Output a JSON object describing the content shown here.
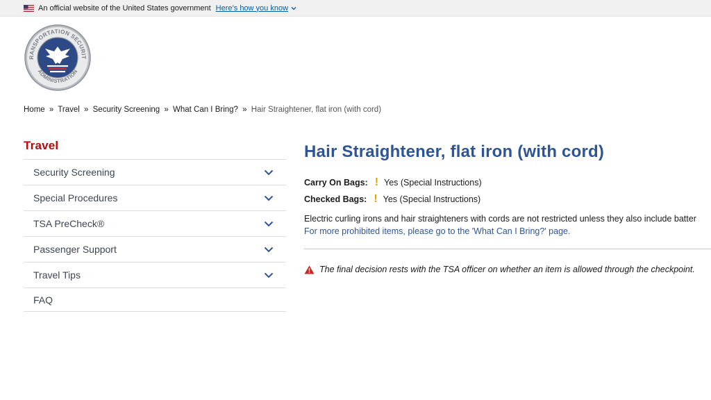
{
  "gov_banner": {
    "text": "An official website of the United States government",
    "link": "Here’s how you know"
  },
  "logo": {
    "text_top": "TRANSPORTATION SECURITY",
    "text_bottom": "ADMINISTRATION"
  },
  "breadcrumb": {
    "items": [
      "Home",
      "Travel",
      "Security Screening",
      "What Can I Bring?"
    ],
    "separator": "»",
    "current": "Hair Straightener, flat iron (with cord)"
  },
  "sidebar": {
    "title": "Travel",
    "items": [
      {
        "label": "Security Screening"
      },
      {
        "label": "Special Procedures"
      },
      {
        "label": "TSA PreCheck®"
      },
      {
        "label": "Passenger Support"
      },
      {
        "label": "Travel Tips"
      },
      {
        "label": "FAQ"
      }
    ]
  },
  "main": {
    "title": "Hair Straightener, flat iron (with cord)",
    "carry_on_label": "Carry On Bags:",
    "carry_on_value": "Yes (Special Instructions)",
    "checked_label": "Checked Bags:",
    "checked_value": "Yes (Special Instructions)",
    "bang": "!",
    "description": "Electric curling irons and hair straighteners with cords are not restricted unless they also include batter",
    "more_link": "For more prohibited items, please go to the 'What Can I Bring?' page.",
    "notice": "The final decision rests with the TSA officer on whether an item is allowed through the checkpoint."
  },
  "colors": {
    "sidebar_title": "#b50909",
    "heading": "#2d5595",
    "link": "#2d5595",
    "warning": "#e5a000",
    "alert": "#c62828"
  }
}
